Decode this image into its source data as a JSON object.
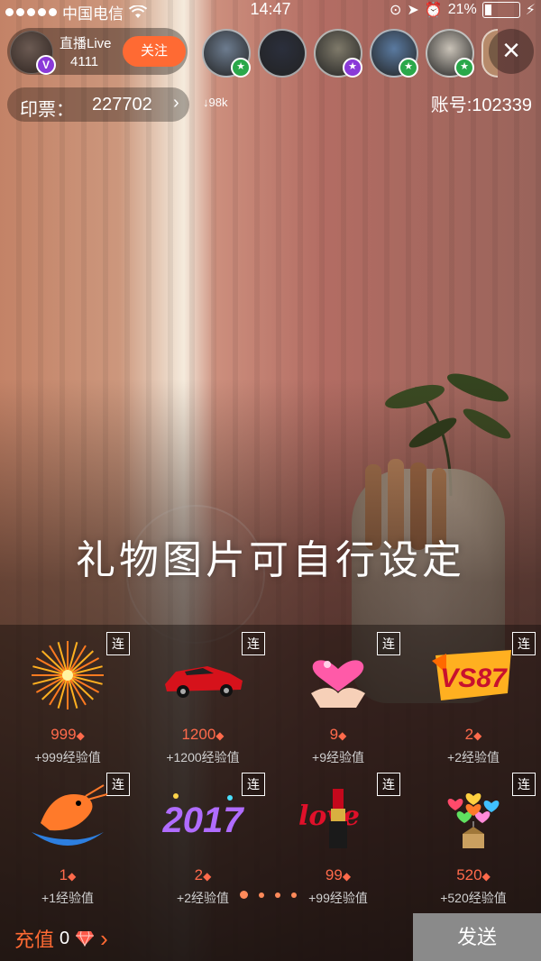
{
  "status_bar": {
    "carrier": "中国电信",
    "time": "14:47",
    "battery": "21%",
    "battery_level": 0.21
  },
  "host": {
    "name": "直播Live",
    "id": "4111",
    "vip_badge": "V",
    "follow_label": "关注"
  },
  "viewers": [
    {
      "badge": "star",
      "badge_color": "#2aa84a",
      "bg": "#6d7c8f"
    },
    {
      "badge": "",
      "badge_color": "",
      "bg": "#2b2f3c"
    },
    {
      "badge": "star",
      "badge_color": "#8a3ad8",
      "bg": "#7f7a6a"
    },
    {
      "badge": "star",
      "badge_color": "#2aa84a",
      "bg": "#5a7aa0"
    },
    {
      "badge": "star",
      "badge_color": "#2aa84a",
      "bg": "#c9c2b7"
    }
  ],
  "header": {
    "ticket_label": "印票：",
    "ticket_value": "227702",
    "down_count": "↓98k",
    "account": "账号:102339",
    "close_icon": "×"
  },
  "watermark": "礼物图片可自行设定",
  "gift_combo_label": "连",
  "gifts": [
    {
      "art": "fireworks",
      "price": "999",
      "exp": "+999经验值"
    },
    {
      "art": "sports-car",
      "price": "1200",
      "exp": "+1200经验值"
    },
    {
      "art": "heart-handshake",
      "price": "9",
      "exp": "+9经验值"
    },
    {
      "art": "vs87-badge",
      "price": "2",
      "exp": "+2经验值"
    },
    {
      "art": "shrimp",
      "price": "1",
      "exp": "+1经验值"
    },
    {
      "art": "2017",
      "price": "2",
      "exp": "+2经验值"
    },
    {
      "art": "lipstick-love",
      "price": "99",
      "exp": "+99经验值"
    },
    {
      "art": "heart-balloons",
      "price": "520",
      "exp": "+520经验值"
    }
  ],
  "footer": {
    "recharge_label": "充值",
    "balance": "0",
    "send_label": "发送"
  },
  "colors": {
    "accent": "#ff6a33",
    "price": "#ff6a4b"
  }
}
